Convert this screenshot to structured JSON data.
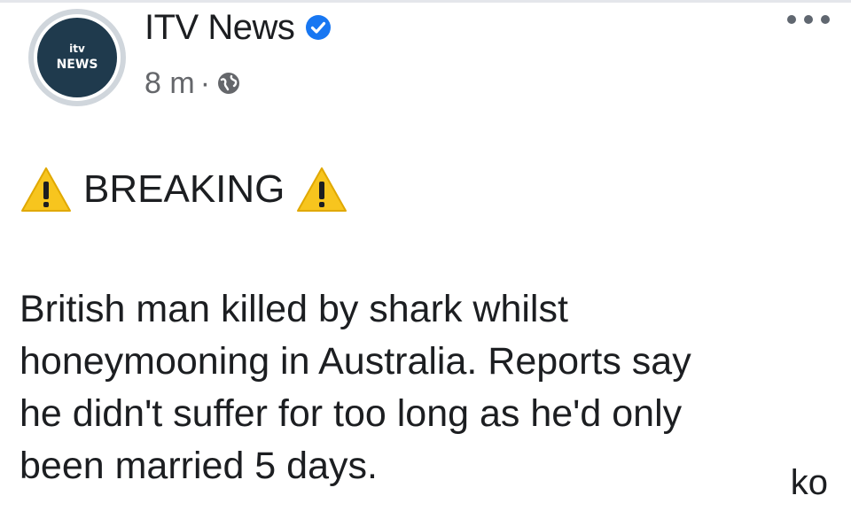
{
  "post": {
    "author": "ITV News",
    "avatar_logo": "itv",
    "avatar_sub": "NEWS",
    "timestamp": "8 m",
    "separator": "·",
    "verified": true,
    "icons": {
      "verified": "verified-badge-icon",
      "audience": "globe-icon",
      "more": "more-options-icon",
      "warning": "warning-icon"
    },
    "colors": {
      "verified_blue": "#1877f2",
      "warning_yellow": "#f7c51e",
      "avatar_bg": "#1f3a4d"
    },
    "headline": "BREAKING",
    "body_lines": [
      "British man killed by shark whilst",
      "honeymooning in Australia. Reports say",
      "he didn't suffer for too long as he'd only",
      "been married 5 days."
    ],
    "watermark": "ko"
  }
}
